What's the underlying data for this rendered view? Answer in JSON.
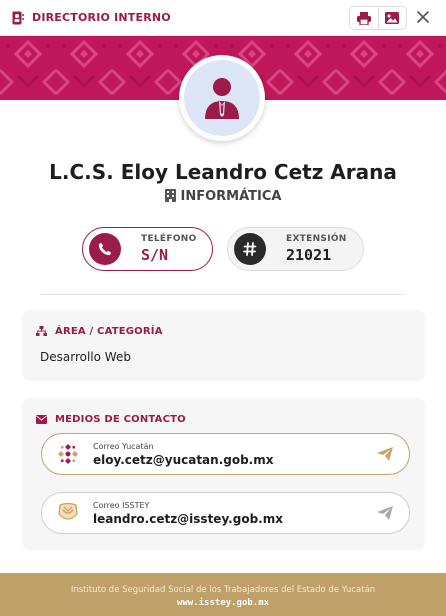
{
  "header": {
    "title": "DIRECTORIO INTERNO",
    "print_icon": "printer-icon",
    "image_icon": "image-icon",
    "close_icon": "close-icon"
  },
  "profile": {
    "name": "L.C.S. Eloy Leandro Cetz Arana",
    "department": "INFORMÁTICA",
    "avatar_icon": "user-tie-icon"
  },
  "phone": {
    "label": "TELÉFONO",
    "value": "S/N"
  },
  "extension": {
    "label": "EXTENSIÓN",
    "value": "21021"
  },
  "area": {
    "title": "ÁREA / CATEGORÍA",
    "value": "Desarrollo Web"
  },
  "contact": {
    "title": "MEDIOS DE CONTACTO",
    "emails": [
      {
        "label": "Correo Yucatán",
        "address": "eloy.cetz@yucatan.gob.mx"
      },
      {
        "label": "Correo ISSTEY",
        "address": "leandro.cetz@isstey.gob.mx"
      }
    ]
  },
  "footer": {
    "institution": "Instituto de Seguridad Social de los Trabajadores del Estado de Yucatán",
    "url": "www.isstey.gob.mx"
  },
  "colors": {
    "brand": "#9b1b4a",
    "banner": "#c0175b",
    "gold": "#bfa068"
  }
}
